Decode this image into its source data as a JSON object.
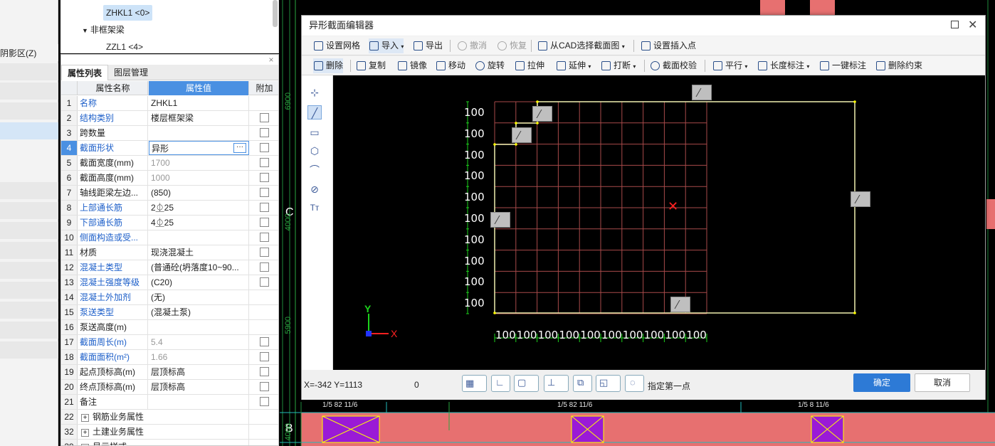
{
  "left_strip": {
    "label": "阴影区(Z)"
  },
  "tree": {
    "items": [
      {
        "label": "ZHKL1 <0>"
      },
      {
        "label": "非框架梁"
      },
      {
        "label": "ZZL1 <4>"
      }
    ]
  },
  "props": {
    "close": "×",
    "tabs": [
      "属性列表",
      "图层管理"
    ],
    "headers": {
      "name": "属性名称",
      "value": "属性值",
      "extra": "附加"
    },
    "rows": [
      {
        "num": "1",
        "name": "名称",
        "value": "ZHKL1",
        "check": false
      },
      {
        "num": "2",
        "name": "结构类别",
        "value": "楼层框架梁",
        "check": true
      },
      {
        "num": "3",
        "name": "跨数量",
        "value": "",
        "check": true
      },
      {
        "num": "4",
        "name": "截面形状",
        "value": "异形",
        "check": true
      },
      {
        "num": "5",
        "name": "截面宽度(mm)",
        "value": "1700",
        "check": true
      },
      {
        "num": "6",
        "name": "截面高度(mm)",
        "value": "1000",
        "check": true
      },
      {
        "num": "7",
        "name": "轴线距梁左边...",
        "value": "(850)",
        "check": true
      },
      {
        "num": "8",
        "name": "上部通长筋",
        "value": "2⏂25",
        "check": true
      },
      {
        "num": "9",
        "name": "下部通长筋",
        "value": "4⏂25",
        "check": true
      },
      {
        "num": "10",
        "name": "侧面构造或受...",
        "value": "",
        "check": true
      },
      {
        "num": "11",
        "name": "材质",
        "value": "现浇混凝土",
        "check": true
      },
      {
        "num": "12",
        "name": "混凝土类型",
        "value": "(普通砼(坍落度10~90...",
        "check": true
      },
      {
        "num": "13",
        "name": "混凝土强度等级",
        "value": "(C20)",
        "check": true
      },
      {
        "num": "14",
        "name": "混凝土外加剂",
        "value": "(无)",
        "check": false
      },
      {
        "num": "15",
        "name": "泵送类型",
        "value": "(混凝土泵)",
        "check": false
      },
      {
        "num": "16",
        "name": "泵送高度(m)",
        "value": "",
        "check": false
      },
      {
        "num": "17",
        "name": "截面周长(m)",
        "value": "5.4",
        "check": true
      },
      {
        "num": "18",
        "name": "截面面积(m²)",
        "value": "1.66",
        "check": true
      },
      {
        "num": "19",
        "name": "起点顶标高(m)",
        "value": "层顶标高",
        "check": true
      },
      {
        "num": "20",
        "name": "终点顶标高(m)",
        "value": "层顶标高",
        "check": true
      },
      {
        "num": "21",
        "name": "备注",
        "value": "",
        "check": true
      },
      {
        "num": "22",
        "name": "钢筋业务属性",
        "value": "",
        "check": false
      },
      {
        "num": "32",
        "name": "土建业务属性",
        "value": "",
        "check": false
      },
      {
        "num": "39",
        "name": "显示样式",
        "value": "",
        "check": false
      }
    ]
  },
  "cad": {
    "axis_labels": {
      "c": "C",
      "b": "B"
    },
    "dims": [
      "6900",
      "4000",
      "5900",
      "4000"
    ],
    "beam_labels": [
      "1/5  82 11/6",
      "1/5  82 11/6",
      "1/5 8  11/6"
    ]
  },
  "dialog": {
    "title": "异形截面编辑器",
    "toolbar1": {
      "set_grid": "设置网格",
      "import": "导入",
      "export": "导出",
      "undo": "撤消",
      "redo": "恢复",
      "from_cad": "从CAD选择截面图",
      "insert_point": "设置插入点"
    },
    "toolbar2": {
      "delete": "删除",
      "copy": "复制",
      "mirror": "镜像",
      "move": "移动",
      "rotate": "旋转",
      "stretch": "拉伸",
      "extend": "延伸",
      "break": "打断",
      "check": "截面校验",
      "parallel": "平行",
      "length_dim": "长度标注",
      "one_click_dim": "一键标注",
      "delete_constraint": "删除约束"
    },
    "grid": {
      "row_labels": [
        "100",
        "100",
        "100",
        "100",
        "100",
        "100",
        "100",
        "100",
        "100",
        "100"
      ],
      "col_labels": [
        "100",
        "100",
        "100",
        "100",
        "100",
        "100",
        "100",
        "100",
        "100",
        "100"
      ]
    },
    "axis": {
      "x": "X",
      "y": "Y"
    },
    "status": {
      "coords": "X=-342 Y=1113",
      "value": "0",
      "hint": "指定第一点",
      "ok": "确定",
      "cancel": "取消"
    }
  }
}
